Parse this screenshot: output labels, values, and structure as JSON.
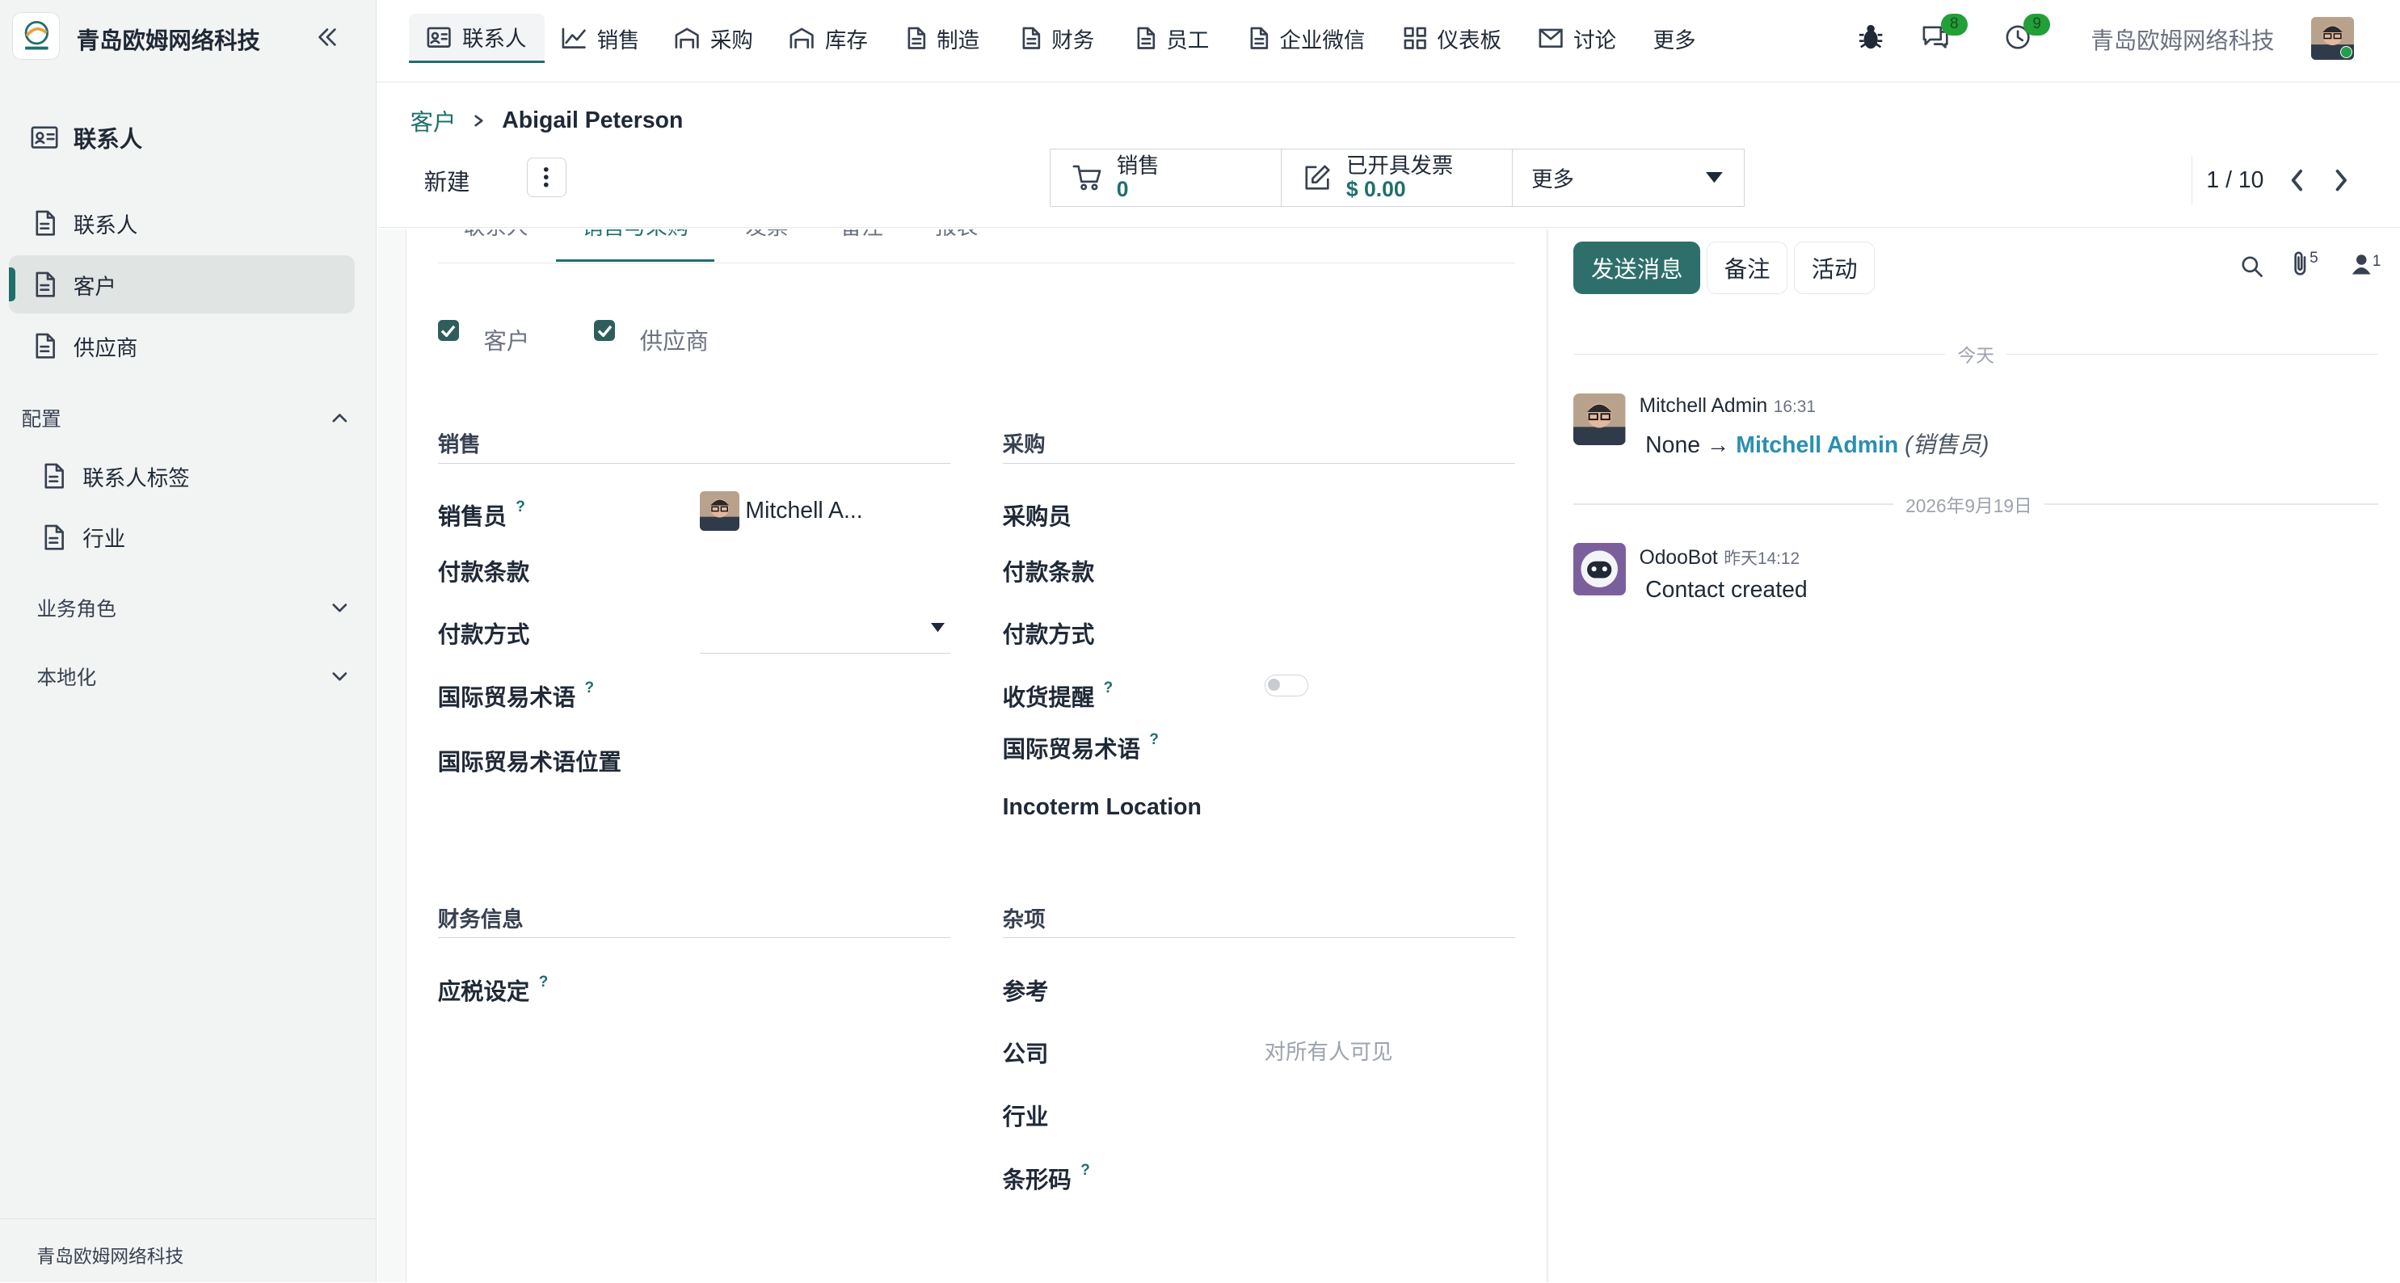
{
  "colors": {
    "brand": "#1f6f6b",
    "primary_button": "#2e6f6b",
    "badge": "#21a038",
    "sidebar_bg": "#f2f4f3"
  },
  "sidebar": {
    "company_name": "青岛欧姆网络科技",
    "app_title": "联系人",
    "items": [
      {
        "label": "联系人",
        "icon": "document-icon"
      },
      {
        "label": "客户",
        "icon": "document-icon",
        "active": true
      },
      {
        "label": "供应商",
        "icon": "document-icon"
      }
    ],
    "config_group": {
      "label": "配置",
      "items": [
        {
          "label": "联系人标签"
        },
        {
          "label": "行业"
        }
      ]
    },
    "groups": [
      {
        "label": "业务角色"
      },
      {
        "label": "本地化"
      }
    ],
    "footer": "青岛欧姆网络科技"
  },
  "topnav": {
    "items": [
      {
        "label": "联系人",
        "icon": "contact-card-icon"
      },
      {
        "label": "销售",
        "icon": "chart-line-icon"
      },
      {
        "label": "采购",
        "icon": "warehouse-icon"
      },
      {
        "label": "库存",
        "icon": "warehouse-icon"
      },
      {
        "label": "制造",
        "icon": "document-icon"
      },
      {
        "label": "财务",
        "icon": "document-icon"
      },
      {
        "label": "员工",
        "icon": "document-icon"
      },
      {
        "label": "企业微信",
        "icon": "document-icon"
      },
      {
        "label": "仪表板",
        "icon": "grid-icon"
      },
      {
        "label": "讨论",
        "icon": "mail-icon"
      },
      {
        "label": "更多",
        "icon": ""
      }
    ],
    "messages_count": "8",
    "activities_count": "9",
    "company": "青岛欧姆网络科技"
  },
  "control": {
    "breadcrumb_parent": "客户",
    "breadcrumb_current": "Abigail Peterson",
    "new_label": "新建",
    "smart_buttons": [
      {
        "label": "销售",
        "value": "0"
      },
      {
        "label": "已开具发票",
        "value": "$ 0.00"
      }
    ],
    "more_label": "更多",
    "pager": "1 / 10"
  },
  "form": {
    "tabs": [
      "联系人",
      "销售与采购",
      "发票",
      "备注",
      "报表"
    ],
    "checkboxes": [
      {
        "label": "客户",
        "checked": true
      },
      {
        "label": "供应商",
        "checked": true
      }
    ],
    "sales": {
      "title": "销售",
      "salesperson_label": "销售员",
      "salesperson_value": "Mitchell A...",
      "payment_terms_label": "付款条款",
      "payment_method_label": "付款方式",
      "incoterm_label": "国际贸易术语",
      "incoterm_location_label": "国际贸易术语位置"
    },
    "purchase": {
      "title": "采购",
      "buyer_label": "采购员",
      "payment_terms_label": "付款条款",
      "payment_method_label": "付款方式",
      "receipt_reminder_label": "收货提醒",
      "incoterm_label": "国际贸易术语",
      "incoterm_location_label": "Incoterm Location"
    },
    "fiscal": {
      "title": "财务信息",
      "fiscal_position_label": "应税设定"
    },
    "misc": {
      "title": "杂项",
      "reference_label": "参考",
      "company_label": "公司",
      "company_placeholder": "对所有人可见",
      "industry_label": "行业",
      "barcode_label": "条形码"
    },
    "help_mark": "?"
  },
  "chatter": {
    "send_label": "发送消息",
    "note_label": "备注",
    "activity_label": "活动",
    "attachments_count": "5",
    "followers_count": "1",
    "messages": [
      {
        "separator": "今天",
        "author": "Mitchell Admin",
        "time": "16:31",
        "old_value": "None",
        "arrow": "→",
        "new_value": "Mitchell Admin",
        "field": "(销售员)"
      },
      {
        "separator": "2026年9月19日",
        "author": "OdooBot",
        "time": "昨天14:12",
        "body": "Contact created"
      }
    ]
  }
}
